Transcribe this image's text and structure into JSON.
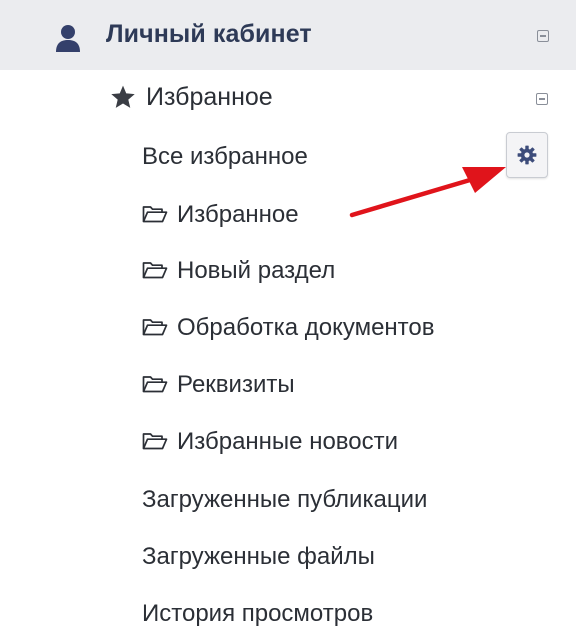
{
  "header": {
    "title": "Личный кабинет",
    "icon": "user-icon",
    "collapse_icon": "collapse-icon"
  },
  "favorites": {
    "label": "Избранное",
    "icon": "star-icon",
    "collapse_icon": "collapse-icon",
    "settings_icon": "gear-icon"
  },
  "menu": {
    "all_favorites": "Все избранное",
    "folders": [
      {
        "label": "Избранное",
        "icon": "folder-open-icon"
      },
      {
        "label": "Новый раздел",
        "icon": "folder-open-icon"
      },
      {
        "label": "Обработка документов",
        "icon": "folder-open-icon"
      },
      {
        "label": "Реквизиты",
        "icon": "folder-open-icon"
      },
      {
        "label": "Избранные новости",
        "icon": "folder-open-icon"
      }
    ],
    "uploaded_publications": "Загруженные публикации",
    "uploaded_files": "Загруженные файлы",
    "view_history": "История просмотров"
  },
  "colors": {
    "header_bg": "#ebecef",
    "header_text": "#2e3a57",
    "icon_blue": "#34406b",
    "arrow_red": "#e0141b"
  }
}
